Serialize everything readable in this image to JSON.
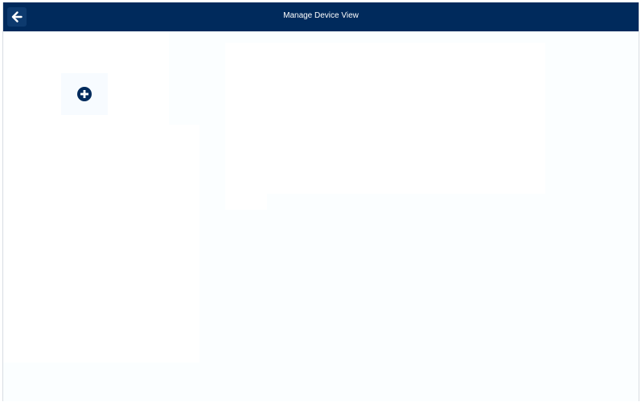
{
  "window": {
    "title": "Manage Device View"
  },
  "header": {
    "back_icon": "arrow-left-icon"
  },
  "sidebar": {
    "add_icon": "plus-circle-icon"
  },
  "colors": {
    "header_bg": "#002a5c",
    "accent": "#002a5c",
    "canvas_bg": "#fbfeff",
    "panel_bg": "#ffffff"
  }
}
